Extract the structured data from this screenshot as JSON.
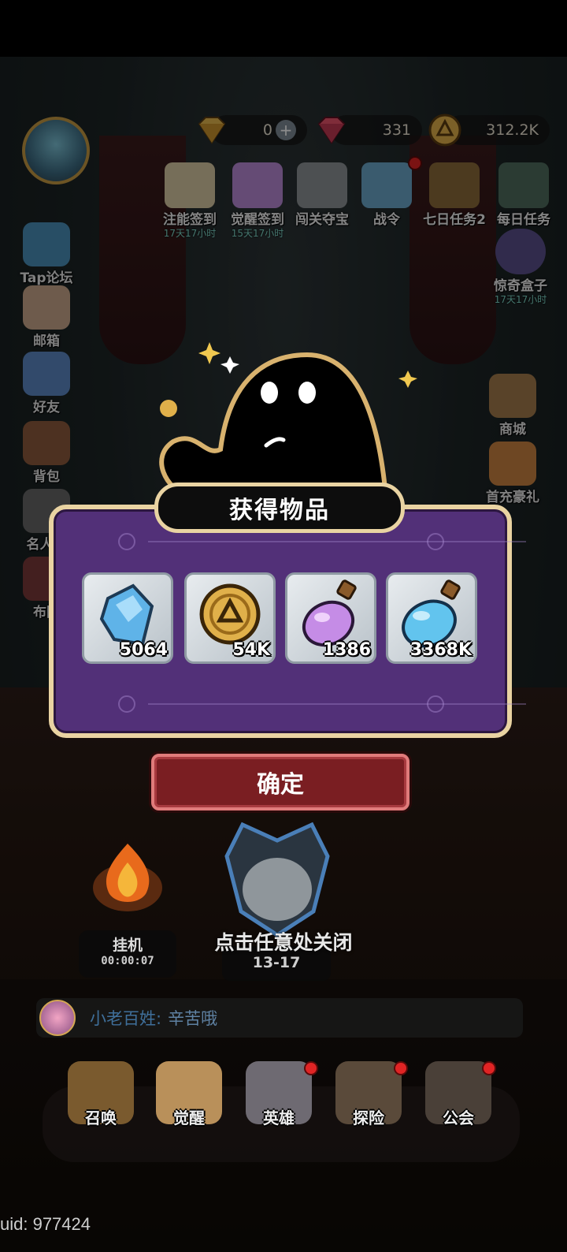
{
  "currencies": {
    "gem_gold": "0",
    "gem_red": "331",
    "gold": "312.2K"
  },
  "top_events": [
    {
      "label": "注能签到",
      "sub": "17天17小时"
    },
    {
      "label": "觉醒签到",
      "sub": "15天17小时"
    },
    {
      "label": "闯关夺宝",
      "sub": ""
    },
    {
      "label": "战令",
      "sub": ""
    },
    {
      "label": "七日任务2",
      "sub": ""
    },
    {
      "label": "每日任务",
      "sub": ""
    }
  ],
  "mystery_box": {
    "label": "惊奇盒子",
    "sub": "17天17小时"
  },
  "left_menu": [
    "Tap论坛",
    "邮箱",
    "好友",
    "背包",
    "名人堂",
    "布阵"
  ],
  "right_menu": [
    "商城",
    "首充豪礼"
  ],
  "modal": {
    "title": "获得物品",
    "items": [
      {
        "name": "crystal",
        "qty": "5064"
      },
      {
        "name": "gold-coin",
        "qty": "54K"
      },
      {
        "name": "purple-potion",
        "qty": "1386"
      },
      {
        "name": "blue-potion",
        "qty": "3368K"
      }
    ],
    "confirm": "确定",
    "close_hint": "点击任意处关闭"
  },
  "afk": {
    "label": "挂机",
    "time": "00:00:07"
  },
  "stage": "13-17",
  "chat": {
    "name": "小老百姓:",
    "message": "辛苦哦"
  },
  "bottom_nav": [
    "召唤",
    "觉醒",
    "英雄",
    "探险",
    "公会"
  ],
  "uid": "uid: 977424"
}
